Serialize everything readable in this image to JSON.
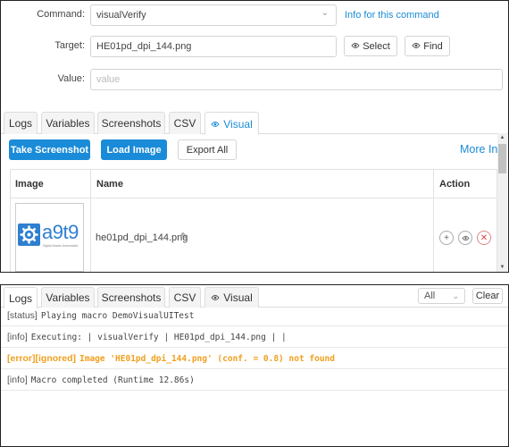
{
  "form": {
    "command_label": "Command",
    "command_value": "visualVerify",
    "command_info_link": "Info for this command",
    "target_label": "Target",
    "target_value": "HE01pd_dpi_144.png",
    "select_label": "Select",
    "find_label": "Find",
    "value_label": "Value",
    "value_placeholder": "value"
  },
  "top_tabs": [
    {
      "label": "Logs"
    },
    {
      "label": "Variables"
    },
    {
      "label": "Screenshots"
    },
    {
      "label": "CSV"
    },
    {
      "label": "Visual",
      "icon": "eye-icon",
      "active": true
    }
  ],
  "visual": {
    "take_screenshot": "Take Screenshot",
    "load_image": "Load Image",
    "export_all": "Export All",
    "more_info": "More Info",
    "columns": {
      "image": "Image",
      "name": "Name",
      "action": "Action"
    },
    "rows": [
      {
        "logo_text": "a9t9",
        "logo_subtext": "Digital Assets Automation",
        "name": "he01pd_dpi_144.png"
      }
    ]
  },
  "bottom_tabs": [
    {
      "label": "Logs",
      "active": true
    },
    {
      "label": "Variables"
    },
    {
      "label": "Screenshots"
    },
    {
      "label": "CSV"
    },
    {
      "label": "Visual",
      "icon": "eye-icon"
    }
  ],
  "log_controls": {
    "filter_value": "All",
    "clear_label": "Clear"
  },
  "logs": [
    {
      "tag": "[status]",
      "message": "Playing macro DemoVisualUITest",
      "type": "status"
    },
    {
      "tag": "[info]",
      "message": "Executing:  | visualVerify | HE01pd_dpi_144.png |  |",
      "type": "info"
    },
    {
      "tag": "[error][ignored]",
      "message": "Image 'HE01pd_dpi_144.png' (conf. = 0.8) not found",
      "type": "error"
    },
    {
      "tag": "[info]",
      "message": "Macro completed (Runtime 12.86s)",
      "type": "info"
    }
  ],
  "colors": {
    "accent": "#1a8bd8",
    "error": "#f0a020"
  }
}
